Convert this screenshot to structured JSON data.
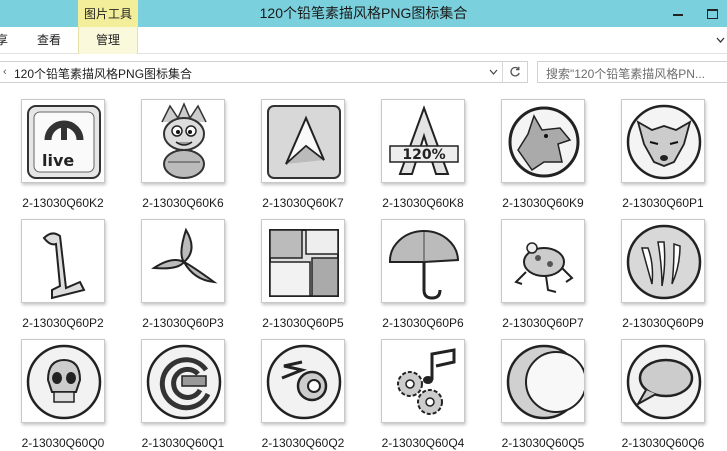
{
  "window": {
    "title": "120个铅笔素描风格PNG图标集合",
    "context_tab_group": "图片工具"
  },
  "ribbon": {
    "tabs": [
      {
        "label": "享"
      },
      {
        "label": "查看"
      },
      {
        "label": "管理"
      }
    ]
  },
  "address": {
    "separator": "‹",
    "path": "120个铅笔素描风格PNG图标集合"
  },
  "search": {
    "placeholder": "搜索\"120个铅笔素描风格PN...",
    "icon": "search-icon"
  },
  "files": [
    {
      "name": "2-13030Q60K2",
      "icon": "ableton-live-icon"
    },
    {
      "name": "2-13030Q60K6",
      "icon": "monkey-mascot-icon"
    },
    {
      "name": "2-13030Q60K7",
      "icon": "triangle-logo-icon"
    },
    {
      "name": "2-13030Q60K8",
      "icon": "a-zoom-120-icon"
    },
    {
      "name": "2-13030Q60K9",
      "icon": "wolf-icon"
    },
    {
      "name": "2-13030Q60P1",
      "icon": "fox-head-icon"
    },
    {
      "name": "2-13030Q60P2",
      "icon": "music-note-icon"
    },
    {
      "name": "2-13030Q60P3",
      "icon": "shuriken-icon"
    },
    {
      "name": "2-13030Q60P5",
      "icon": "patchwork-icon"
    },
    {
      "name": "2-13030Q60P6",
      "icon": "umbrella-icon"
    },
    {
      "name": "2-13030Q60P7",
      "icon": "frog-icon"
    },
    {
      "name": "2-13030Q60P9",
      "icon": "claw-circle-icon"
    },
    {
      "name": "2-13030Q60Q0",
      "icon": "skull-icon"
    },
    {
      "name": "2-13030Q60Q1",
      "icon": "torrent-icon"
    },
    {
      "name": "2-13030Q60Q2",
      "icon": "blender-icon"
    },
    {
      "name": "2-13030Q60Q4",
      "icon": "gears-note-icon"
    },
    {
      "name": "2-13030Q60Q5",
      "icon": "eclipse-icon"
    },
    {
      "name": "2-13030Q60Q6",
      "icon": "speech-bubble-icon"
    }
  ]
}
